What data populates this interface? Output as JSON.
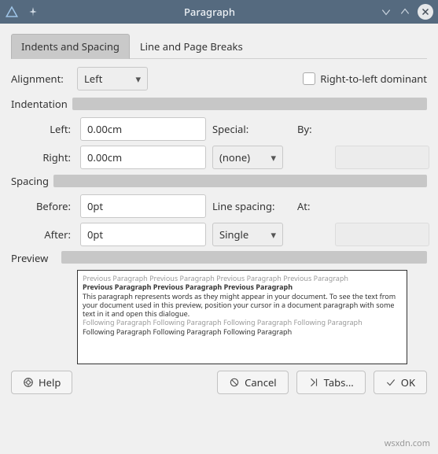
{
  "window": {
    "title": "Paragraph"
  },
  "tabs": {
    "active": "Indents and Spacing",
    "other": "Line and Page Breaks"
  },
  "alignment": {
    "label": "Alignment:",
    "value": "Left",
    "rtl_label": "Right-to-left dominant"
  },
  "indentation": {
    "section": "Indentation",
    "left_label": "Left:",
    "left_value": "0.00cm",
    "right_label": "Right:",
    "right_value": "0.00cm",
    "special_label": "Special:",
    "special_value": "(none)",
    "by_label": "By:"
  },
  "spacing": {
    "section": "Spacing",
    "before_label": "Before:",
    "before_value": "0pt",
    "after_label": "After:",
    "after_value": "0pt",
    "line_label": "Line spacing:",
    "line_value": "Single",
    "at_label": "At:"
  },
  "preview": {
    "label": "Preview",
    "dim1": "Previous Paragraph Previous Paragraph Previous Paragraph Previous Paragraph",
    "bold1": "Previous Paragraph Previous Paragraph Previous Paragraph",
    "body1": "This paragraph represents words as they might appear in your document.  To see the text from your document used in this preview, position your cursor in a document paragraph with some text in it and open this dialogue.",
    "dim2": "Following Paragraph Following Paragraph Following Paragraph Following Paragraph",
    "bold2": "Following Paragraph Following Paragraph Following Paragraph"
  },
  "buttons": {
    "help": "Help",
    "cancel": "Cancel",
    "tabs": "Tabs...",
    "ok": "OK"
  },
  "watermark": "wsxdn.com"
}
